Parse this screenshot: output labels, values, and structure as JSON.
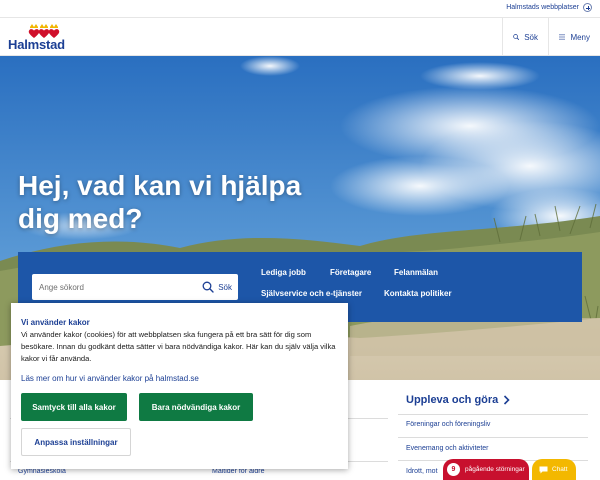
{
  "utility": {
    "sites_label": "Halmstads webbplatser"
  },
  "header": {
    "logo_text": "Halmstad",
    "search_label": "Sök",
    "menu_label": "Meny"
  },
  "hero": {
    "title": "Hej, vad kan vi hjälpa dig med?"
  },
  "search": {
    "placeholder": "Ange sökord",
    "button_label": "Sök"
  },
  "quick_links": [
    "Lediga jobb",
    "Företagare",
    "Felanmälan",
    "Självservice och e-tjänster",
    "Kontakta politiker"
  ],
  "cookie": {
    "title": "Vi använder kakor",
    "text": "Vi använder kakor (cookies) för att webbplatsen ska fungera på ett bra sätt för dig som besökare. Innan du godkänt detta sätter vi bara nödvändiga kakor. Här kan du själv välja vilka kakor vi får använda.",
    "link": "Läs mer om hur vi använder kakor på halmstad.se",
    "accept_all": "Samtyck till alla kakor",
    "necessary_only": "Bara nödvändiga kakor",
    "customize": "Anpassa inställningar"
  },
  "lower": {
    "left_item": "Gymnasieskola",
    "middle_item": "Måltider för äldre",
    "uppleva_heading": "Uppleva och göra",
    "uppleva_items": [
      "Föreningar och föreningsliv",
      "Evenemang och aktiviteter",
      "Idrott, mot"
    ]
  },
  "disturbances": {
    "count": "9",
    "label": "pågående störningar"
  },
  "chat": {
    "label": "Chatt"
  },
  "colors": {
    "brand_blue": "#1c3f94",
    "search_box_blue": "#1d56a8",
    "cookie_green": "#0f7a43",
    "alert_red": "#c8102e",
    "chat_yellow": "#f3b800"
  }
}
